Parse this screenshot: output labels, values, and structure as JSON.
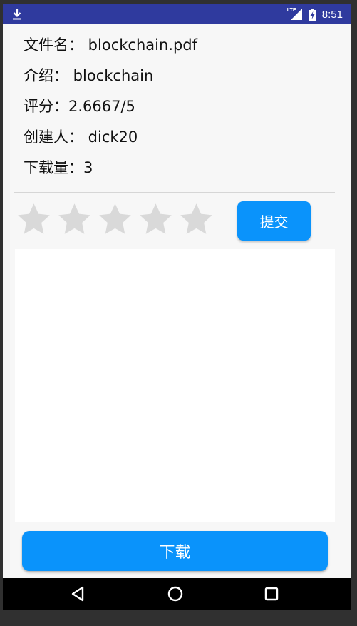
{
  "status_bar": {
    "time": "8:51",
    "network": "LTE",
    "download_icon": "download-icon",
    "signal_icon": "signal-icon",
    "battery_icon": "battery-charging-icon",
    "background": "#2f3a9e"
  },
  "file_info": {
    "rows": [
      {
        "label": "文件名：",
        "value": " blockchain.pdf"
      },
      {
        "label": "介绍：",
        "value": " blockchain"
      },
      {
        "label": "评分：",
        "value": "2.6667/5"
      },
      {
        "label": "创建人：",
        "value": " dick20"
      },
      {
        "label": "下载量：",
        "value": "3"
      }
    ]
  },
  "rating": {
    "max_stars": 5,
    "selected_stars": 0,
    "star_icon": "star-icon",
    "star_color": "#d9d9d9",
    "submit_label": "提交"
  },
  "comment": {
    "value": ""
  },
  "download_label": "下载",
  "accent_color": "#0a93fb",
  "nav_bar": {
    "back_icon": "back-icon",
    "home_icon": "home-icon",
    "recents_icon": "recents-icon"
  }
}
